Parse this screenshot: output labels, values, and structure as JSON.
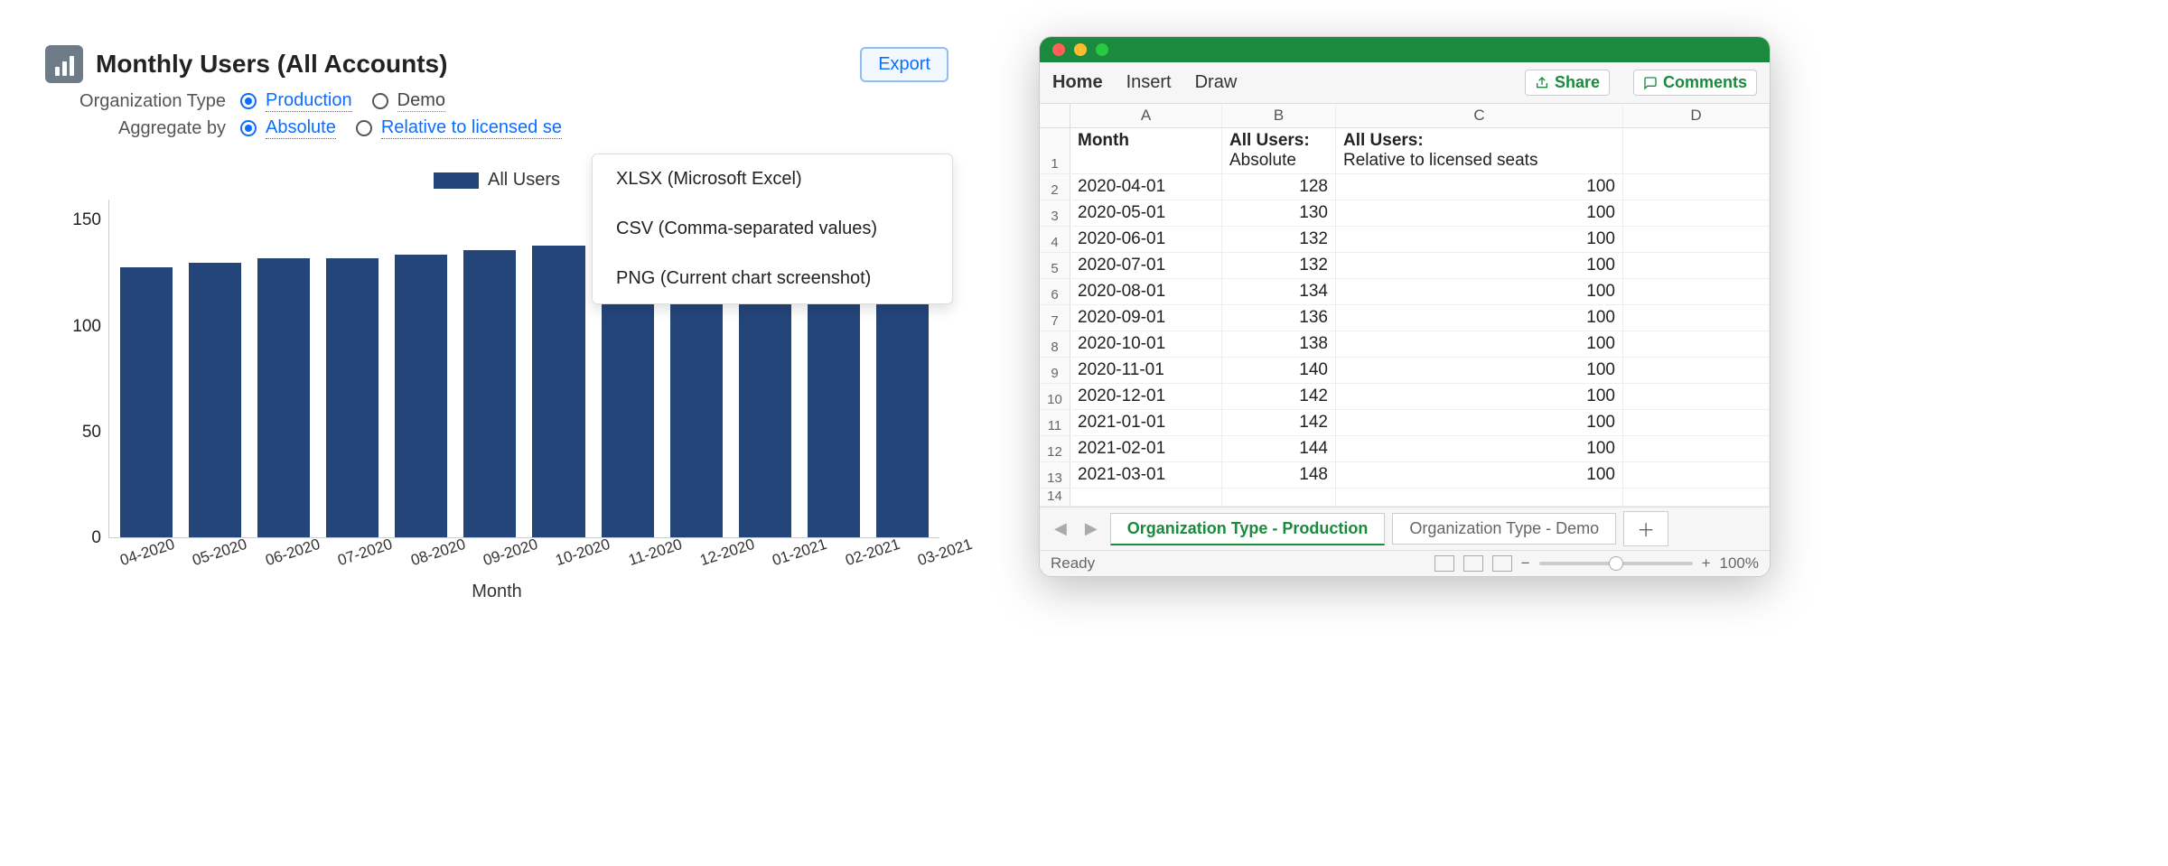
{
  "dash": {
    "title": "Monthly Users (All Accounts)",
    "export": "Export",
    "filters": {
      "org_label": "Organization Type",
      "org_opts": [
        "Production",
        "Demo"
      ],
      "org_selected": 0,
      "agg_label": "Aggregate by",
      "agg_opts": [
        "Absolute",
        "Relative to licensed se"
      ],
      "agg_selected": 0
    },
    "dropdown": [
      "XLSX (Microsoft Excel)",
      "CSV (Comma-separated values)",
      "PNG (Current chart screenshot)"
    ],
    "legend": "All Users",
    "x_title": "Month"
  },
  "chart_data": {
    "type": "bar",
    "categories": [
      "04-2020",
      "05-2020",
      "06-2020",
      "07-2020",
      "08-2020",
      "09-2020",
      "10-2020",
      "11-2020",
      "12-2020",
      "01-2021",
      "02-2021",
      "03-2021"
    ],
    "values": [
      128,
      130,
      132,
      132,
      134,
      136,
      138,
      140,
      142,
      142,
      144,
      148
    ],
    "title": "Monthly Users (All Accounts)",
    "xlabel": "Month",
    "ylabel": "",
    "ylim": [
      0,
      160
    ],
    "yticks": [
      0,
      50,
      100,
      150
    ]
  },
  "excel": {
    "toolbar": {
      "tabs": [
        "Home",
        "Insert",
        "Draw"
      ],
      "share": "Share",
      "comments": "Comments"
    },
    "col_letters": [
      "A",
      "B",
      "C",
      "D"
    ],
    "header_row": {
      "A": "Month",
      "B1": "All Users:",
      "B2": "Absolute",
      "C1": "All Users:",
      "C2": "Relative to licensed seats"
    },
    "rows": [
      {
        "m": "2020-04-01",
        "a": 128,
        "r": 100
      },
      {
        "m": "2020-05-01",
        "a": 130,
        "r": 100
      },
      {
        "m": "2020-06-01",
        "a": 132,
        "r": 100
      },
      {
        "m": "2020-07-01",
        "a": 132,
        "r": 100
      },
      {
        "m": "2020-08-01",
        "a": 134,
        "r": 100
      },
      {
        "m": "2020-09-01",
        "a": 136,
        "r": 100
      },
      {
        "m": "2020-10-01",
        "a": 138,
        "r": 100
      },
      {
        "m": "2020-11-01",
        "a": 140,
        "r": 100
      },
      {
        "m": "2020-12-01",
        "a": 142,
        "r": 100
      },
      {
        "m": "2021-01-01",
        "a": 142,
        "r": 100
      },
      {
        "m": "2021-02-01",
        "a": 144,
        "r": 100
      },
      {
        "m": "2021-03-01",
        "a": 148,
        "r": 100
      }
    ],
    "sheets": [
      "Organization Type - Production",
      "Organization Type - Demo"
    ],
    "active_sheet": 0,
    "status": "Ready",
    "zoom": "100%",
    "minus": "−",
    "plus": "+"
  }
}
